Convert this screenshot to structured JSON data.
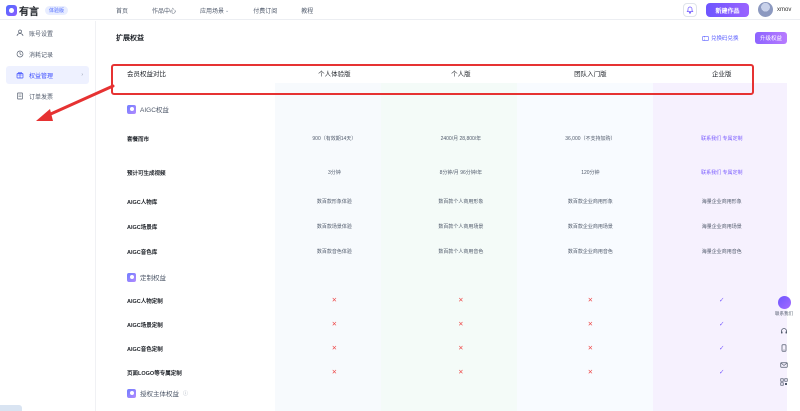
{
  "header": {
    "brand": "有言",
    "edition_badge": "体验版",
    "nav": [
      {
        "label": "首页"
      },
      {
        "label": "作品中心"
      },
      {
        "label": "应用场景"
      },
      {
        "label": "付费订阅"
      },
      {
        "label": "教程"
      }
    ],
    "create_label": "新建作品",
    "username": "xmov"
  },
  "sidebar": {
    "items": [
      {
        "label": "账号设置",
        "icon": "user-icon"
      },
      {
        "label": "消耗记录",
        "icon": "clock-icon"
      },
      {
        "label": "权益管理",
        "icon": "benefits-icon"
      },
      {
        "label": "订单发票",
        "icon": "invoice-icon"
      }
    ]
  },
  "main": {
    "title": "扩展权益",
    "redeem_label": "兑换码兑换",
    "upgrade_label": "升级权益"
  },
  "table": {
    "columns": [
      "会员权益对比",
      "个人体验版",
      "个人版",
      "团队入门版",
      "企业版"
    ],
    "sections": [
      {
        "title": "AIGC权益",
        "rows": [
          {
            "label": "套餐而市",
            "values": [
              "900（有效期14天）",
              "2400/月 28,800/年",
              "36,000（不支持加购）",
              "联系我们 专属定制"
            ]
          },
          {
            "label": "预计可生成视频",
            "values": [
              "3分钟",
              "8分钟/月 96分钟/年",
              "120分钟",
              "联系我们 专属定制"
            ]
          },
          {
            "label": "AIGC人物库",
            "values": [
              "数百款形象体验",
              "数百款个人商用形象",
              "数百款企业商用形象",
              "海量企业商用形象"
            ]
          },
          {
            "label": "AIGC场景库",
            "values": [
              "数百款场景体验",
              "数百款个人商用场景",
              "数百款企业商用场景",
              "海量企业商用场景"
            ]
          },
          {
            "label": "AIGC音色库",
            "values": [
              "数百款音色体验",
              "数百款个人商用音色",
              "数百款企业商用音色",
              "海量企业商用音色"
            ]
          }
        ]
      },
      {
        "title": "定制权益",
        "rows": [
          {
            "label": "AIGC人物定制",
            "values": [
              "✕",
              "✕",
              "✕",
              "✓"
            ]
          },
          {
            "label": "AIGC场景定制",
            "values": [
              "✕",
              "✕",
              "✕",
              "✓"
            ]
          },
          {
            "label": "AIGC音色定制",
            "values": [
              "✕",
              "✕",
              "✕",
              "✓"
            ]
          },
          {
            "label": "页面LOGO等专属定制",
            "values": [
              "✕",
              "✕",
              "✕",
              "✓"
            ]
          }
        ]
      },
      {
        "title": "授权主体权益"
      }
    ]
  },
  "float": {
    "help_label": "联系我们"
  },
  "colors": {
    "accent": "#7a5cff",
    "annotation_red": "#e63232",
    "cross_red": "#ee4b4b"
  }
}
